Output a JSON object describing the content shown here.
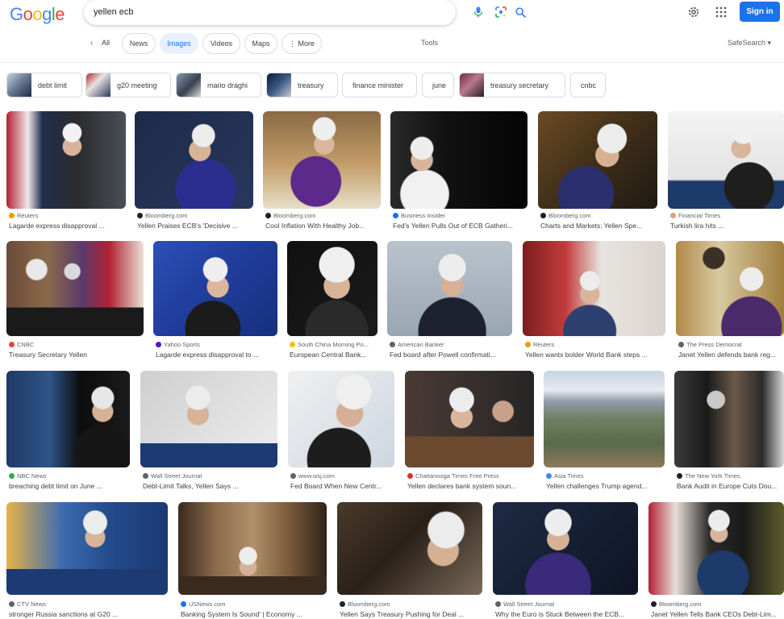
{
  "header": {
    "logo_letters": [
      "G",
      "o",
      "o",
      "g",
      "l",
      "e"
    ],
    "query": "yellen ecb",
    "signin_label": "Sign in"
  },
  "nav": {
    "back_label": "‹",
    "all_label": "All",
    "tabs": [
      "News",
      "Images",
      "Videos",
      "Maps",
      "⋮ More"
    ],
    "active_tab": "Images",
    "tools_label": "Tools",
    "safesearch_label": "SafeSearch ▾"
  },
  "chips": [
    "debt limit",
    "g20 meeting",
    "mario draghi",
    "treasury",
    "finance minister",
    "june",
    "treasury secretary",
    "cnbc"
  ],
  "results": [
    {
      "source": "Reuters",
      "title": "Lagarde express disapproval ...",
      "fav": "#f29900"
    },
    {
      "source": "Bloomberg.com",
      "title": "Yellen Praises ECB's 'Decisive ...",
      "fav": "#202124"
    },
    {
      "source": "Bloomberg.com",
      "title": "Cool Inflation With Healthy Job...",
      "fav": "#202124"
    },
    {
      "source": "Business Insider",
      "title": "Fed's Yellen Pulls Out of ECB Gatheri...",
      "fav": "#1a73e8"
    },
    {
      "source": "Bloomberg.com",
      "title": "Charts and Markets: Yellen Spe...",
      "fav": "#202124"
    },
    {
      "source": "Financial Times",
      "title": "Turkish lira hits ...",
      "fav": "#d9a37a"
    },
    {
      "source": "CNBC",
      "title": "Treasury Secretary Yellen",
      "fav": "#ea4335"
    },
    {
      "source": "Yahoo Sports",
      "title": "Lagarde express disapproval to ...",
      "fav": "#6001d2"
    },
    {
      "source": "South China Morning Po...",
      "title": "European Central Bank...",
      "fav": "#fbbc05"
    },
    {
      "source": "American Banker",
      "title": "Fed board after Powell confirmati...",
      "fav": "#5f6368"
    },
    {
      "source": "Reuters",
      "title": "Yellen wants bolder World Bank steps ...",
      "fav": "#f29900"
    },
    {
      "source": "The Press Democrat",
      "title": "Janet Yellen defends bank reg...",
      "fav": "#5f6368"
    },
    {
      "source": "NBC News",
      "title": "breaching debt limit on June ...",
      "fav": "#34a853"
    },
    {
      "source": "Wall Street Journal",
      "title": "Debt-Limit Talks, Yellen Says ...",
      "fav": "#5f6368"
    },
    {
      "source": "www.wsj.com",
      "title": "Fed Board When New Centr...",
      "fav": "#5f6368"
    },
    {
      "source": "Chattanooga Times Free Press",
      "title": "Yellen declares bank system soun...",
      "fav": "#d93025"
    },
    {
      "source": "Asia Times",
      "title": "Yellen challenges Trump agend...",
      "fav": "#4285f4"
    },
    {
      "source": "The New York Times",
      "title": "Bank Audit in Europe Cuts Dou...",
      "fav": "#202124"
    },
    {
      "source": "CTV News",
      "title": "stronger Russia sanctions at G20 ...",
      "fav": "#5f6368"
    },
    {
      "source": "USNews.com",
      "title": "Banking System Is Sound' | Economy ...",
      "fav": "#1a73e8"
    },
    {
      "source": "Bloomberg.com",
      "title": "Yellen Says Treasury Pushing for Deal ...",
      "fav": "#202124"
    },
    {
      "source": "Wall Street Journal",
      "title": "Why the Euro is Stuck Between the ECB...",
      "fav": "#5f6368"
    },
    {
      "source": "Bloomberg.com",
      "title": "Janet Yellen Tells Bank CEOs Debt-Lim...",
      "fav": "#202124"
    }
  ]
}
